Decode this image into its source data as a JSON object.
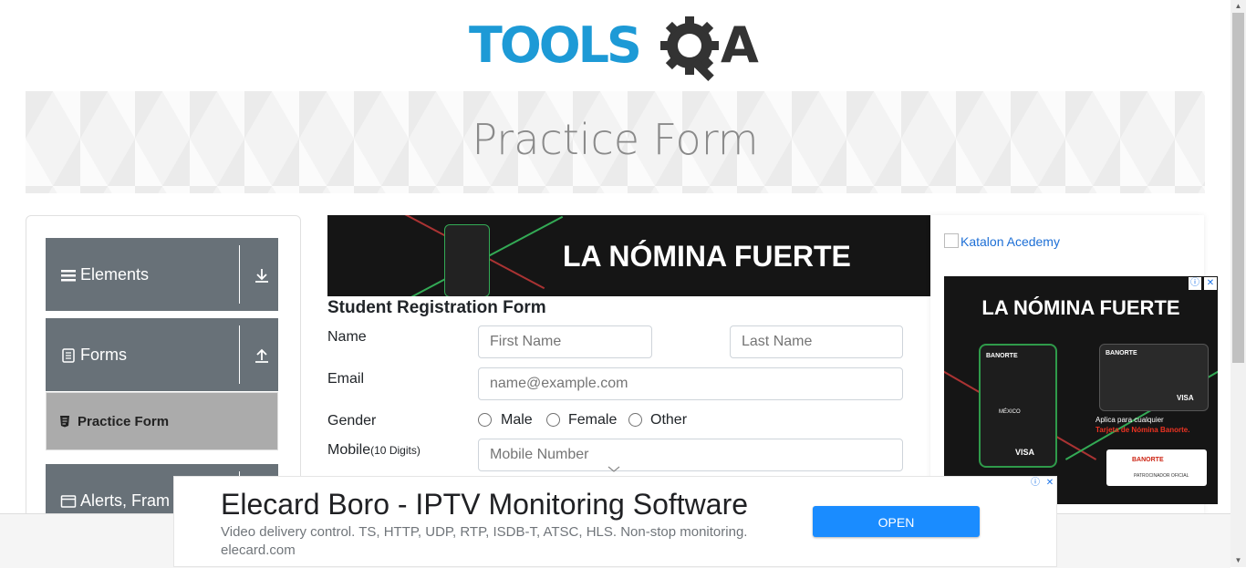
{
  "logo": {
    "text": "TOOLSQA",
    "wordmark_left": "TOOLS",
    "wordmark_right": "A",
    "colors": {
      "primary": "#1d9ad6",
      "secondary": "#333333"
    }
  },
  "banner": {
    "title": "Practice Form"
  },
  "sidebar": {
    "groups": [
      {
        "label": "Elements",
        "icon": "hamburger-icon",
        "toggle_icon": "download-arrow-icon"
      },
      {
        "label": "Forms",
        "icon": "document-icon",
        "toggle_icon": "upload-arrow-icon"
      },
      {
        "label": "Alerts, Frame & Windows",
        "visible_label": "Alerts, Fram",
        "icon": "window-icon"
      }
    ],
    "active_item": {
      "label": "Practice Form",
      "icon": "form-icon"
    }
  },
  "main_ad": {
    "headline": "LA NÓMINA FUERTE"
  },
  "form": {
    "title": "Student Registration Form",
    "name_label": "Name",
    "first_name_placeholder": "First Name",
    "last_name_placeholder": "Last Name",
    "email_label": "Email",
    "email_placeholder": "name@example.com",
    "gender_label": "Gender",
    "gender_options": [
      "Male",
      "Female",
      "Other"
    ],
    "mobile_label": "Mobile",
    "mobile_hint": "(10 Digits)",
    "mobile_placeholder": "Mobile Number"
  },
  "right_col": {
    "katalon_alt": "Katalon Acedemy",
    "side_ad": {
      "headline": "LA NÓMINA FUERTE",
      "card_text": "BANORTE",
      "card_country": "MÉXICO",
      "visa": "VISA",
      "promo_line1": "Aplica para cualquier",
      "promo_line2": "Tarjeta de Nómina Banorte.",
      "footer": "PATROCINADOR OFICIAL"
    }
  },
  "bottom_ad": {
    "headline": "Elecard Boro - IPTV Monitoring Software",
    "description": "Video delivery control. TS, HTTP, UDP, RTP, ISDB-T, ATSC, HLS. Non-stop monitoring.",
    "url": "elecard.com",
    "button": "OPEN"
  },
  "ad_choices": {
    "info": "ⓘ",
    "close": "✕"
  }
}
